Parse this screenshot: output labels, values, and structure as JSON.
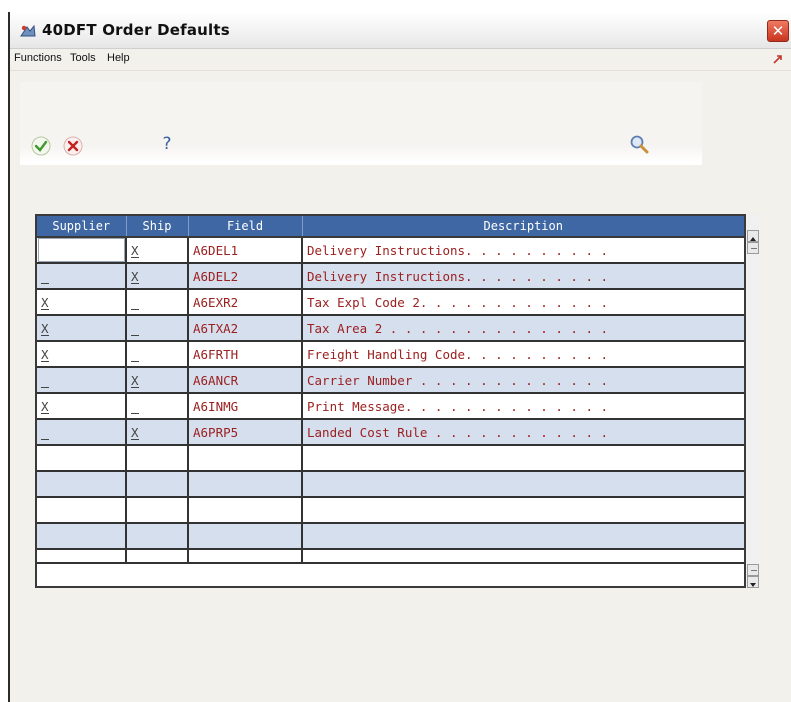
{
  "window": {
    "title": "40DFT   Order Defaults",
    "close_glyph": "✕"
  },
  "menu": {
    "items": [
      {
        "label": "Functions"
      },
      {
        "label": "Tools"
      },
      {
        "label": "Help"
      }
    ]
  },
  "toolbar": {
    "ok_icon": "checkmark-icon",
    "cancel_icon": "cancel-x-icon",
    "help_glyph": "?",
    "search_icon": "magnifier-icon",
    "ok_color": "#3e9a2e",
    "cancel_color": "#c42121"
  },
  "grid": {
    "columns": [
      "Supplier",
      "Ship",
      "Field",
      "Description"
    ],
    "rows": [
      {
        "supplier": "",
        "ship": "X",
        "field": "A6DEL1",
        "description": "Delivery Instructions. . . . . . . . . ."
      },
      {
        "supplier": "_",
        "ship": "X",
        "field": "A6DEL2",
        "description": "Delivery Instructions. . . . . . . . . ."
      },
      {
        "supplier": "X",
        "ship": "_",
        "field": "A6EXR2",
        "description": "Tax Expl Code 2. . . . . . . . . . . . ."
      },
      {
        "supplier": "X",
        "ship": "_",
        "field": "A6TXA2",
        "description": "Tax Area 2 . . . . . . . . . . . . . . ."
      },
      {
        "supplier": "X",
        "ship": "_",
        "field": "A6FRTH",
        "description": "Freight Handling Code. . . . . . . . . ."
      },
      {
        "supplier": "_",
        "ship": "X",
        "field": "A6ANCR",
        "description": "Carrier Number . . . . . . . . . . . . ."
      },
      {
        "supplier": "X",
        "ship": "_",
        "field": "A6INMG",
        "description": "Print Message. . . . . . . . . . . . . ."
      },
      {
        "supplier": "_",
        "ship": "X",
        "field": "A6PRP5",
        "description": "Landed Cost Rule . . . . . . . . . . . ."
      },
      {
        "supplier": "",
        "ship": "",
        "field": "",
        "description": ""
      },
      {
        "supplier": "",
        "ship": "",
        "field": "",
        "description": ""
      },
      {
        "supplier": "",
        "ship": "",
        "field": "",
        "description": ""
      },
      {
        "supplier": "",
        "ship": "",
        "field": "",
        "description": ""
      },
      {
        "supplier": "",
        "ship": "",
        "field": "",
        "description": ""
      }
    ],
    "header_color": "#3f67a4",
    "alt_row_color": "#d6dfee",
    "field_text_color": "#9b2020"
  }
}
